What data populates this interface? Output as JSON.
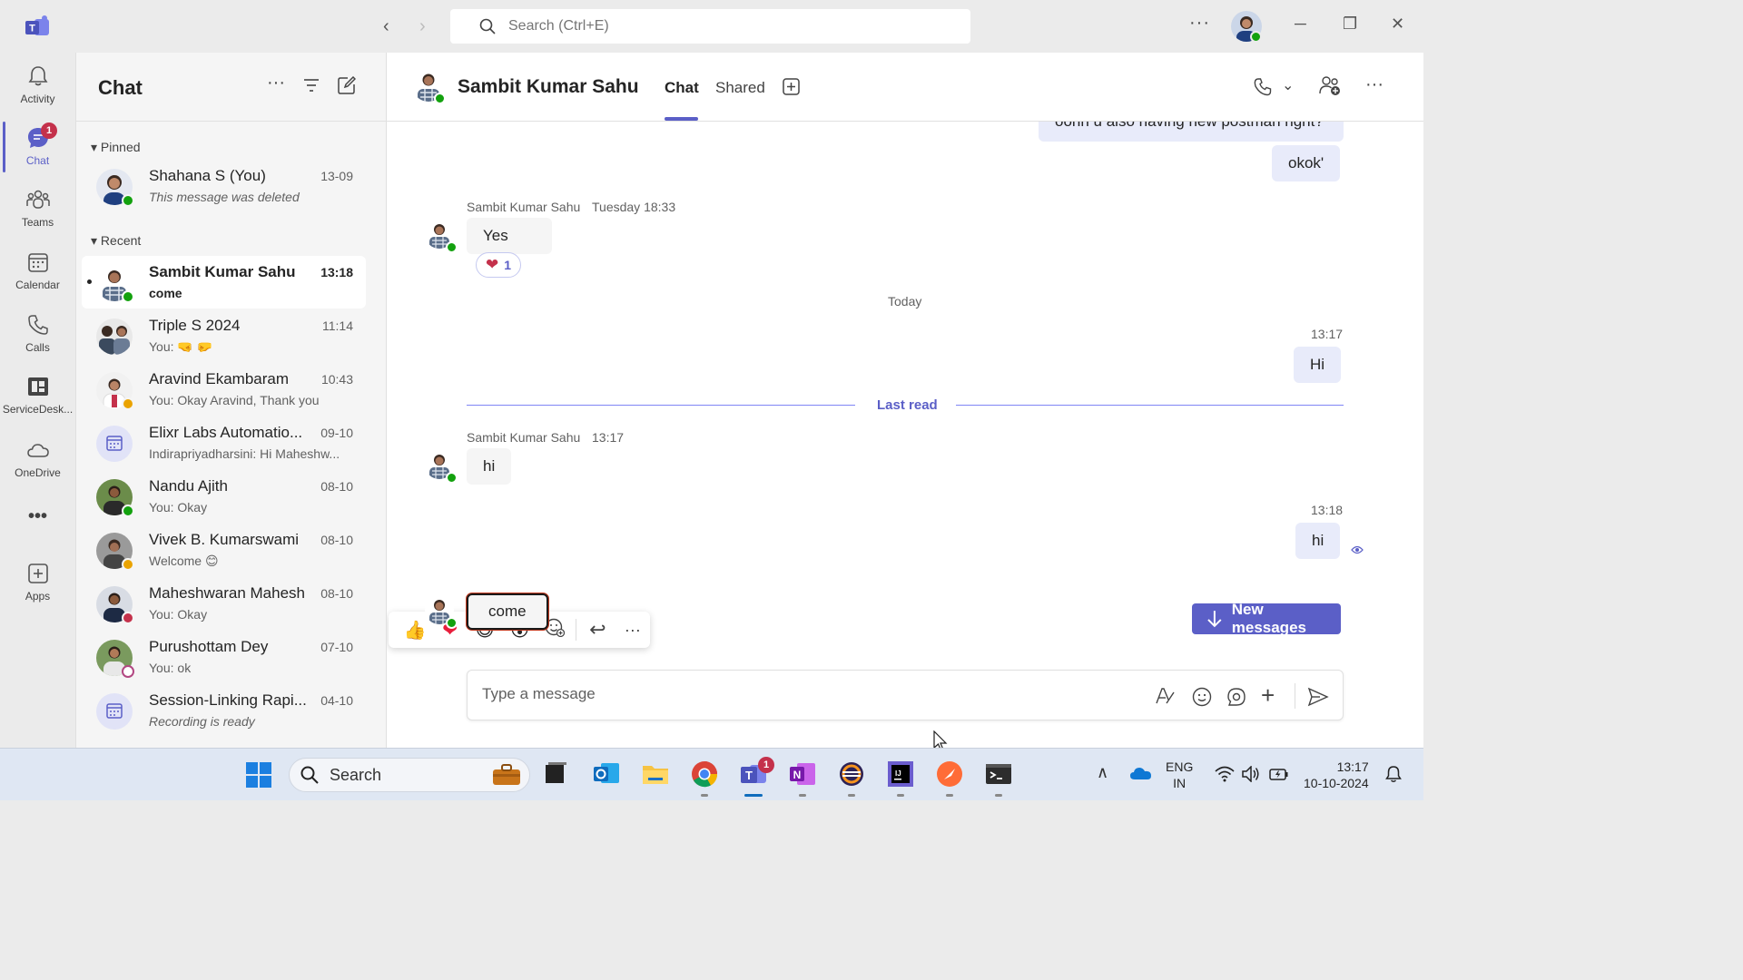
{
  "titlebar": {
    "search_placeholder": "Search (Ctrl+E)",
    "more_label": "···",
    "minimize_label": "─",
    "restore_label": "❐",
    "close_label": "✕"
  },
  "rail": {
    "items": [
      {
        "label": "Activity",
        "icon": "bell-icon"
      },
      {
        "label": "Chat",
        "icon": "chat-icon",
        "badge": "1"
      },
      {
        "label": "Teams",
        "icon": "teams-icon"
      },
      {
        "label": "Calendar",
        "icon": "calendar-icon"
      },
      {
        "label": "Calls",
        "icon": "phone-icon"
      },
      {
        "label": "ServiceDesk...",
        "icon": "servicedesk-icon"
      },
      {
        "label": "OneDrive",
        "icon": "cloud-icon"
      },
      {
        "label": "•••",
        "icon": "more-icon"
      },
      {
        "label": "Apps",
        "icon": "apps-icon"
      }
    ]
  },
  "chatlist": {
    "title": "Chat",
    "pinned_label": "Pinned",
    "recent_label": "Recent",
    "pinned": [
      {
        "name": "Shahana S (You)",
        "time": "13-09",
        "preview": "This message was deleted",
        "status": "#13a10e"
      }
    ],
    "recent": [
      {
        "name": "Sambit Kumar Sahu",
        "time": "13:18",
        "preview": "come",
        "status": "#13a10e"
      },
      {
        "name": "Triple S 2024",
        "time": "11:14",
        "preview": "You: 🤜 🤛",
        "status": ""
      },
      {
        "name": "Aravind Ekambaram",
        "time": "10:43",
        "preview": "You: Okay Aravind, Thank you",
        "status": "#eaa300"
      },
      {
        "name": "Elixr Labs Automatio...",
        "time": "09-10",
        "preview": "Indirapriyadharsini: Hi Maheshw...",
        "status": ""
      },
      {
        "name": "Nandu Ajith",
        "time": "08-10",
        "preview": "You: Okay",
        "status": "#13a10e"
      },
      {
        "name": "Vivek B. Kumarswami",
        "time": "08-10",
        "preview": "Welcome 😊",
        "status": "#eaa300"
      },
      {
        "name": "Maheshwaran Mahesh",
        "time": "08-10",
        "preview": "You: Okay",
        "status": "#c4314b"
      },
      {
        "name": "Purushottam Dey",
        "time": "07-10",
        "preview": "You: ok",
        "status": "#b24782"
      },
      {
        "name": "Session-Linking Rapi...",
        "time": "04-10",
        "preview": "Recording is ready",
        "status": ""
      }
    ]
  },
  "conversation": {
    "contact_name": "Sambit Kumar Sahu",
    "tabs": [
      "Chat",
      "Shared"
    ],
    "messages": {
      "out_partial": "oohh u also having new postman right?",
      "out_okok": "okok'",
      "in1_sender": "Sambit Kumar Sahu",
      "in1_time": "Tuesday 18:33",
      "in1_text": "Yes",
      "in1_reaction_count": "1",
      "today_label": "Today",
      "out_hi1_time": "13:17",
      "out_hi1_text": "Hi",
      "last_read_label": "Last read",
      "in2_sender": "Sambit Kumar Sahu",
      "in2_time": "13:17",
      "in2_text": "hi",
      "out_hi2_time": "13:18",
      "out_hi2_text": "hi",
      "in3_text": "come"
    },
    "new_messages_label": "New messages",
    "compose_placeholder": "Type a message"
  },
  "taskbar": {
    "search_label": "Search",
    "teams_badge": "1",
    "lang_line1": "ENG",
    "lang_line2": "IN",
    "clock_time": "13:17",
    "clock_date": "10-10-2024"
  },
  "colors": {
    "accent": "#5b5fc7",
    "online": "#13a10e",
    "away": "#eaa300",
    "busy": "#c4314b"
  }
}
